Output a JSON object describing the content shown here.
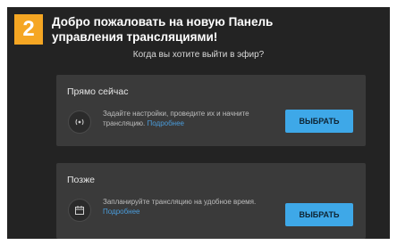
{
  "step": {
    "number": "2"
  },
  "header": {
    "title_line1": "Добро пожаловать на новую Панель",
    "title_line2": "управления трансляциями!",
    "prompt": "Когда вы хотите выйти в эфир?"
  },
  "options": [
    {
      "title": "Прямо сейчас",
      "icon": "live-broadcast-icon",
      "description": "Задайте настройки, проведите их и начните трансляцию.",
      "link": "Подробнее",
      "button": "ВЫБРАТЬ"
    },
    {
      "title": "Позже",
      "icon": "calendar-icon",
      "description": "Запланируйте трансляцию на удобное время.",
      "link": "Подробнее",
      "button": "ВЫБРАТЬ"
    }
  ],
  "colors": {
    "badge": "#f5a623",
    "accent": "#3ea8e8",
    "link": "#4a9cdb",
    "background": "#232323",
    "card": "#3a3a3a"
  }
}
